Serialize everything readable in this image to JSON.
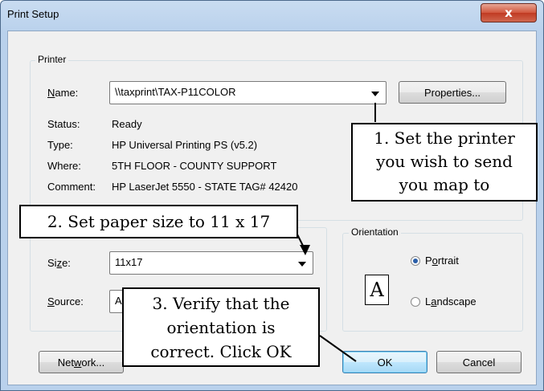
{
  "window": {
    "title": "Print Setup",
    "close_glyph": "x"
  },
  "printer_group": {
    "label": "Printer",
    "name_label": "Name:",
    "name_value": "\\\\taxprint\\TAX-P11COLOR",
    "properties_button": "Properties...",
    "status_label": "Status:",
    "status_value": "Ready",
    "type_label": "Type:",
    "type_value": "HP Universal Printing PS (v5.2)",
    "where_label": "Where:",
    "where_value": "5TH FLOOR - COUNTY SUPPORT",
    "comment_label": "Comment:",
    "comment_value": "HP LaserJet 5550 - STATE TAG# 42420"
  },
  "paper_group": {
    "size_label": "Size:",
    "size_value": "11x17",
    "source_label": "Source:",
    "source_value": "A"
  },
  "orientation_group": {
    "label": "Orientation",
    "icon_letter": "A",
    "portrait_label": "Portrait",
    "landscape_label": "Landscape",
    "selected": "Portrait"
  },
  "buttons": {
    "network": "Network...",
    "ok": "OK",
    "cancel": "Cancel"
  },
  "callouts": {
    "c1": [
      "1. Set the printer",
      "you wish to send",
      "you map to"
    ],
    "c2": "2. Set paper size to 11 x 17",
    "c3": [
      "3. Verify that the",
      "orientation is",
      "correct. Click OK"
    ]
  },
  "colors": {
    "close_button": "#c9452e",
    "title_bar": "#b9d1ec",
    "dialog_bg": "#f0f0f0",
    "default_button_border": "#3c7fb1"
  }
}
